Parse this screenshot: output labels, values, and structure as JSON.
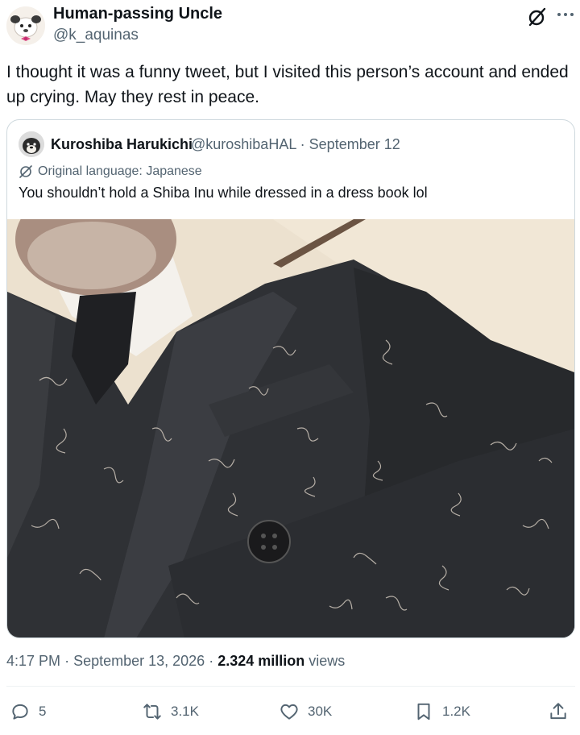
{
  "author": {
    "display_name": "Human-passing Uncle",
    "handle": "@k_aquinas"
  },
  "icons": {
    "header": [
      "grok-icon",
      "more-icon"
    ],
    "actions": [
      "reply-icon",
      "retweet-icon",
      "like-icon",
      "bookmark-icon",
      "share-icon"
    ]
  },
  "tweet": {
    "text": "I thought it was a funny tweet, but I visited this person’s account and ended up crying. May they rest in peace."
  },
  "quote": {
    "display_name": "Kuroshiba Harukichi",
    "meta": "@kuroshibaHAL · September 12",
    "language_note": "Original language: Japanese",
    "text": "You shouldn’t hold a Shiba Inu while dressed in a dress book lol"
  },
  "meta": {
    "time": "4:17 PM",
    "date": "September 13, 2026",
    "views_count": "2.324 million",
    "views_label": "views",
    "separator": "·"
  },
  "actions": {
    "reply": "5",
    "retweet": "3.1K",
    "like": "30K",
    "bookmark": "1.2K"
  },
  "colors": {
    "text_primary": "#0f1419",
    "text_secondary": "#536471",
    "border": "#cfd9de",
    "suit": "#2f3135",
    "wall": "#e9ddc8"
  }
}
